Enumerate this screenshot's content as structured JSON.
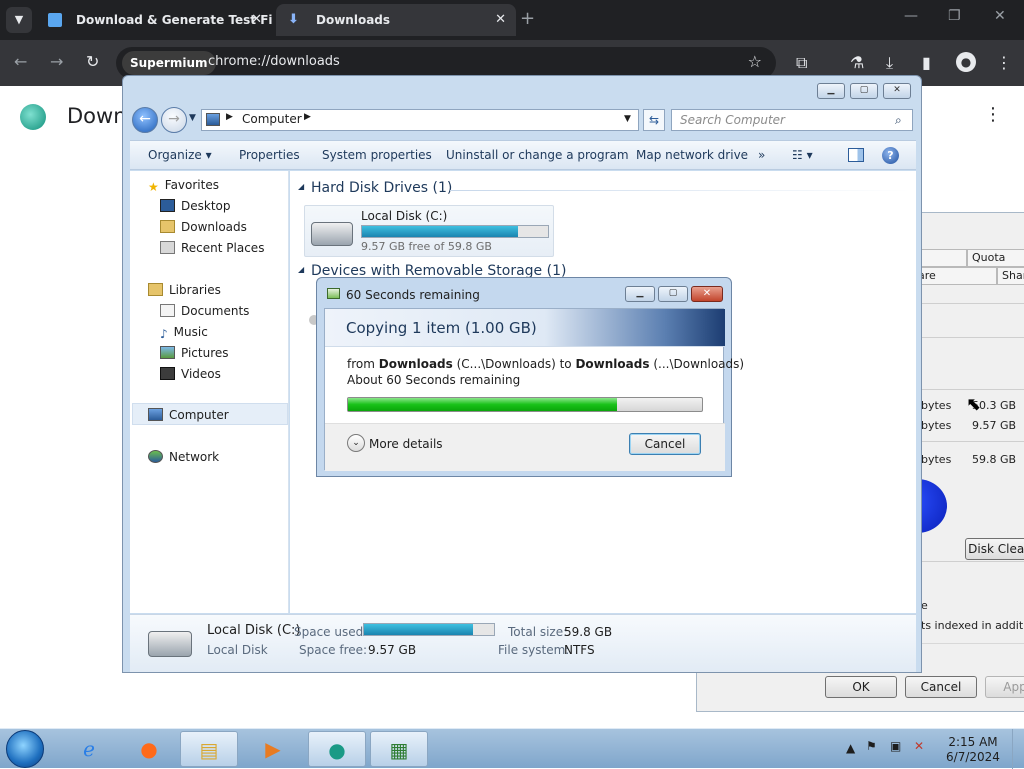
{
  "browser": {
    "tabs": [
      {
        "title": "Download & Generate Test File",
        "close": "✕"
      },
      {
        "title": "Downloads",
        "close": "✕"
      }
    ],
    "new_tab": "+",
    "window_controls": {
      "minimize": "—",
      "restore": "❐",
      "close": "✕"
    },
    "site_chip": "Supermium",
    "url": "chrome://downloads",
    "page_title": "Downloads",
    "kebab": "⋮"
  },
  "explorer": {
    "address_label": "Computer",
    "search_placeholder": "Search Computer",
    "commands": [
      "Organize",
      "Properties",
      "System properties",
      "Uninstall or change a program",
      "Map network drive"
    ],
    "more": "»",
    "nav": {
      "favorites": "Favorites",
      "desktop": "Desktop",
      "downloads": "Downloads",
      "recent": "Recent Places",
      "libraries": "Libraries",
      "documents": "Documents",
      "music": "Music",
      "pictures": "Pictures",
      "videos": "Videos",
      "computer": "Computer",
      "network": "Network"
    },
    "groups": {
      "hdd": "Hard Disk Drives (1)",
      "removable": "Devices with Removable Storage (1)"
    },
    "drive": {
      "name": "Local Disk (C:)",
      "free_text": "9.57 GB free of 59.8 GB",
      "used_fraction": 0.84
    },
    "details": {
      "name": "Local Disk (C:)",
      "type": "Local Disk",
      "space_used_label": "Space used:",
      "space_free_label": "Space free:",
      "space_free": "9.57 GB",
      "total_label": "Total size:",
      "total": "59.8 GB",
      "fs_label": "File system:",
      "fs": "NTFS"
    }
  },
  "properties_window": {
    "tabs_row1": [
      "ns",
      "Quota"
    ],
    "tabs_row2": [
      "dware",
      "Sharin"
    ],
    "rows": [
      {
        "label": "bytes",
        "value": "50.3 GB"
      },
      {
        "label": "bytes",
        "value": "9.57 GB"
      },
      {
        "label": "bytes",
        "value": "59.8 GB"
      }
    ],
    "disk_cleanup": "Disk Clean",
    "indexed_text": "ts indexed in addition",
    "stray_char": "e",
    "ok": "OK",
    "cancel": "Cancel",
    "apply": "App"
  },
  "copy_dialog": {
    "title": "60 Seconds remaining",
    "heading": "Copying 1 item (1.00 GB)",
    "from_word": "from",
    "from_bold": "Downloads",
    "from_path": "(C...\\Downloads)",
    "to_word": "to",
    "to_bold": "Downloads",
    "to_path": "(...\\Downloads)",
    "remaining": "About 60 Seconds remaining",
    "progress": 0.76,
    "more_details": "More details",
    "cancel": "Cancel"
  },
  "taskbar": {
    "time": "2:15 AM",
    "date": "6/7/2024"
  }
}
